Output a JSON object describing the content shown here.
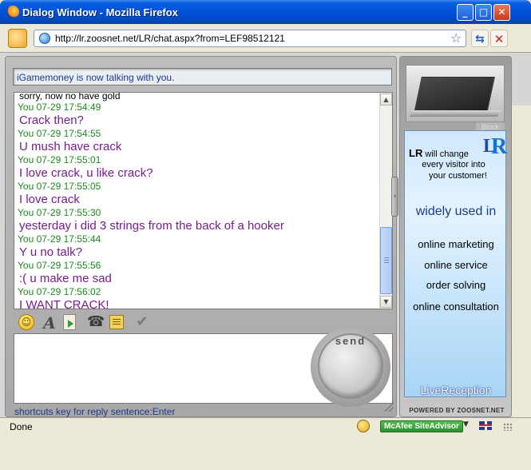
{
  "window": {
    "title": "Dialog Window - Mozilla Firefox",
    "minimize": "_",
    "maximize": "□",
    "close": "✕"
  },
  "navbar": {
    "url": "http://lr.zoosnet.net/LR/chat.aspx?from=LEF98512121",
    "star_glyph": "☆",
    "refresh_glyph": "⇆",
    "stop_glyph": "✕"
  },
  "chat": {
    "status_text": "iGamemoney is now talking with you.",
    "first_line": "sorry, now  no have gold",
    "messages": [
      {
        "header": "You 07-29 17:54:49",
        "body": "Crack then?"
      },
      {
        "header": "You 07-29 17:54:55",
        "body": "U mush have crack"
      },
      {
        "header": "You 07-29 17:55:01",
        "body": "I love crack, u like crack?"
      },
      {
        "header": "You 07-29 17:55:05",
        "body": "I love crack"
      },
      {
        "header": "You 07-29 17:55:30",
        "body": "yesterday i did 3 strings from the back of a hooker"
      },
      {
        "header": "You 07-29 17:55:44",
        "body": "Y u no talk?"
      },
      {
        "header": "You 07-29 17:55:56",
        "body": ":( u make me sad"
      },
      {
        "header": "You 07-29 17:56:02",
        "body": "I WANT CRACK!"
      }
    ],
    "scroll_up_glyph": "▲",
    "scroll_down_glyph": "▼",
    "toolbar": {
      "smile_glyph": "☺",
      "font_glyph": "A",
      "phone_glyph": "☎",
      "check_glyph": "✔"
    },
    "send_label": "send",
    "shortcut_text": "shortcuts key for reply sentence:Enter",
    "collapse_glyph": "›"
  },
  "ad": {
    "block_label": "Block",
    "logo_l": "L",
    "logo_r": "R",
    "line1_brand": "LR",
    "line1_rest": " will change",
    "line2": "every visitor into",
    "line3": "your customer!",
    "headline": "widely used in",
    "items": [
      "online marketing",
      "online service",
      "order solving",
      "online consultation"
    ],
    "brand": "LiveReception",
    "powered": "POWERED BY ZOOSNET.NET"
  },
  "statusbar": {
    "text": "Done",
    "mcafee": "McAfee SiteAdvisor",
    "arrow_glyph": "▼"
  },
  "colors": {
    "title_bar": "#0052d6",
    "message_header": "#1d8a1d",
    "message_body": "#7a1b8e",
    "status_text": "#1b3a8a"
  }
}
